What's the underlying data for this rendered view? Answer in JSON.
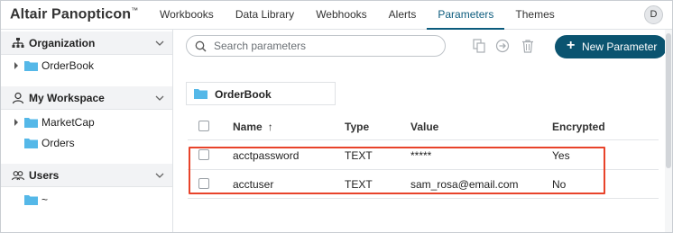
{
  "app": {
    "title": "Altair Panopticon",
    "trademark": "™"
  },
  "nav": {
    "items": [
      {
        "label": "Workbooks"
      },
      {
        "label": "Data Library"
      },
      {
        "label": "Webhooks"
      },
      {
        "label": "Alerts"
      },
      {
        "label": "Parameters",
        "active": true
      },
      {
        "label": "Themes"
      }
    ],
    "avatar_initial": "D"
  },
  "sidebar": {
    "organization": {
      "label": "Organization",
      "items": [
        {
          "label": "OrderBook"
        }
      ]
    },
    "workspace": {
      "label": "My Workspace",
      "items": [
        {
          "label": "MarketCap"
        },
        {
          "label": "Orders"
        }
      ]
    },
    "users": {
      "label": "Users",
      "items": [
        {
          "label": "~"
        }
      ]
    }
  },
  "toolbar": {
    "search_placeholder": "Search parameters",
    "new_button_label": "New Parameter",
    "icons": [
      "copy-icon",
      "move-icon",
      "trash-icon"
    ]
  },
  "breadcrumb": {
    "folder": "OrderBook"
  },
  "table": {
    "headers": {
      "name": "Name",
      "sort_arrow": "↑",
      "type": "Type",
      "value": "Value",
      "encrypted": "Encrypted"
    },
    "rows": [
      {
        "name": "acctpassword",
        "type": "TEXT",
        "value": "*****",
        "encrypted": "Yes"
      },
      {
        "name": "acctuser",
        "type": "TEXT",
        "value": "sam_rosa@email.com",
        "encrypted": "No"
      }
    ]
  },
  "colors": {
    "accent": "#0b5b7d",
    "button": "#0b5470",
    "folder": "#55b8e8",
    "highlight": "#e8432a"
  }
}
